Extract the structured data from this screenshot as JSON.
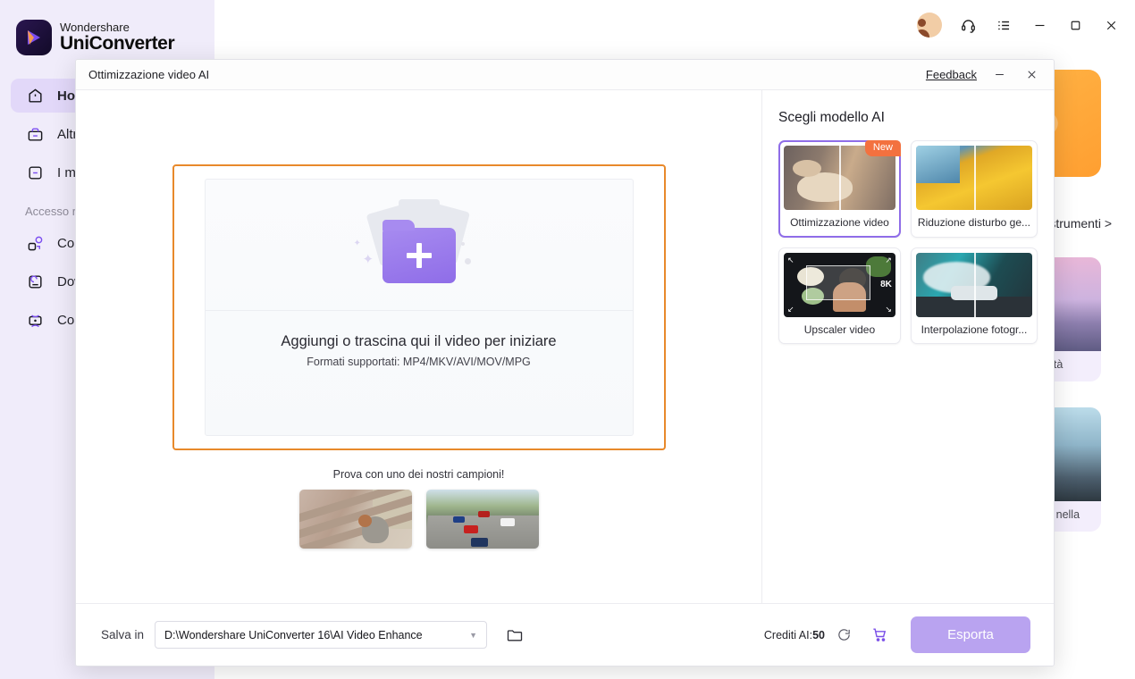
{
  "app": {
    "brand_top": "Wondershare",
    "brand_bottom": "UniConverter"
  },
  "titlebar": {
    "account_icon": "account-avatar-icon",
    "support_icon": "headset-icon",
    "menu_icon": "list-menu-icon",
    "minimize_icon": "minimize-icon",
    "maximize_icon": "maximize-icon",
    "close_icon": "close-icon"
  },
  "sidebar": {
    "items": [
      {
        "label": "Home",
        "icon": "home-icon",
        "active": true
      },
      {
        "label": "Altri strumenti",
        "icon": "toolbox-icon",
        "active": false
      },
      {
        "label": "I miei file",
        "icon": "files-icon",
        "active": false
      }
    ],
    "section_label": "Accesso rapido",
    "quick_items": [
      {
        "label": "Converti",
        "icon": "convert-icon"
      },
      {
        "label": "Downloader",
        "icon": "download-icon"
      },
      {
        "label": "Comprimi",
        "icon": "compress-icon"
      }
    ]
  },
  "background": {
    "tools_link": "Altri strumenti >",
    "cards": [
      {
        "caption": "Migliora la qualità"
      },
      {
        "caption": "Rimuovi oggetti nella"
      }
    ]
  },
  "modal": {
    "title": "Ottimizzazione video AI",
    "feedback": "Feedback",
    "minimize_icon": "minimize-icon",
    "close_icon": "close-icon",
    "dropzone": {
      "title": "Aggiungi o trascina qui il video per iniziare",
      "subtitle": "Formati supportati: MP4/MKV/AVI/MOV/MPG",
      "icon": "add-folder-icon"
    },
    "samples": {
      "label": "Prova con uno dei nostri campioni!",
      "items": [
        {
          "name": "sample-squirrel"
        },
        {
          "name": "sample-traffic"
        }
      ]
    },
    "models": {
      "title": "Scegli modello AI",
      "items": [
        {
          "label": "Ottimizzazione video",
          "badge": "New",
          "selected": true,
          "thumb": "th-dog"
        },
        {
          "label": "Riduzione disturbo ge...",
          "badge": "",
          "selected": false,
          "thumb": "th-autumn"
        },
        {
          "label": "Upscaler video",
          "badge": "",
          "selected": false,
          "thumb": "th-upscale",
          "overlay": "8K"
        },
        {
          "label": "Interpolazione fotogr...",
          "badge": "",
          "selected": false,
          "thumb": "th-drift"
        }
      ]
    },
    "footer": {
      "save_label": "Salva in",
      "save_path": "D:\\Wondershare UniConverter 16\\AI Video Enhance",
      "folder_icon": "folder-open-icon",
      "credits_label": "Crediti AI:",
      "credits_value": "50",
      "refresh_icon": "refresh-icon",
      "cart_icon": "shopping-cart-icon",
      "export_label": "Esporta"
    }
  },
  "colors": {
    "accent_purple": "#8f6de8",
    "accent_orange": "#e8892b",
    "badge_new": "#f3713f",
    "sidebar_bg": "#f0ecfa",
    "export_btn": "#b9a3f0"
  }
}
